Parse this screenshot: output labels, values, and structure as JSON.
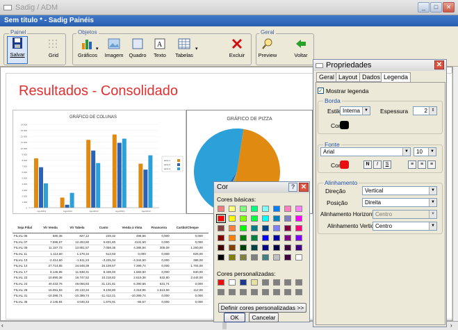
{
  "window": {
    "title": "Sadig / ADM",
    "doc_title": "Sem título * - Sadig Painéis"
  },
  "toolbar": {
    "painel_label": "Painel",
    "objetos_label": "Objetos",
    "geral_label": "Geral",
    "salvar": "Salvar",
    "grid": "Grid",
    "graficos": "Gráficos",
    "imagem": "Imagem",
    "quadro": "Quadro",
    "texto": "Texto",
    "tabelas": "Tabelas",
    "excluir": "Excluir",
    "preview": "Preview",
    "voltar": "Voltar"
  },
  "report": {
    "title": "Resultados - Consolidado",
    "bar_chart_title": "GRÁFICO DE COLUNAS",
    "pie_chart_title": "GRÁFICO DE PIZZA"
  },
  "table": {
    "headers": [
      "Seja Filial",
      "Vlr Venda",
      "Vlr Tabela",
      "Custo",
      "Venda à Vista",
      "Financeira",
      "Cartão/Cheque",
      ""
    ],
    "rows": [
      [
        "FILIAL 06",
        "590,36",
        "827,12",
        "249,32",
        "498,66",
        "0,000",
        "0,000",
        ""
      ],
      [
        "FILIAL 07",
        "7.596,67",
        "12.263,80",
        "6.831,80",
        "4131,50",
        "0,000",
        "0,000",
        ""
      ],
      [
        "FILIAL 09",
        "11.157,73",
        "13.861,57",
        "7.058,35",
        "4.386,94",
        "305,09",
        "1.260,00",
        ""
      ],
      [
        "FILIAL 11",
        "1.113,60",
        "1.179,34",
        "513,93",
        "0,000",
        "0,000",
        "825,00",
        ""
      ],
      [
        "FILIAL 13",
        "-2.414,60",
        "-1.511,23",
        "-3.225,34",
        "-4.344,50",
        "0,000",
        "388,00",
        ""
      ],
      [
        "FILIAL 14",
        "27.714,85",
        "34.548,39",
        "16.109,57",
        "7.399,74",
        "0,000",
        "1.704,00",
        ""
      ],
      [
        "FILIAL 17",
        "8.146,85",
        "11.938,31",
        "8.438,40",
        "1.683,50",
        "0,000",
        "840,00",
        ""
      ],
      [
        "FILIAL 23",
        "10.990,36",
        "19.747,52",
        "10.218,82",
        "2.619,38",
        "632,80",
        "2.444,00",
        ""
      ],
      [
        "FILIAL 24",
        "40.433,76",
        "49.066,83",
        "31.131,81",
        "6.390,66",
        "631,74",
        "0,000",
        ""
      ],
      [
        "FILIAL 28",
        "16.051,83",
        "20.133,34",
        "9.108,80",
        "4.318,95",
        "1.513,60",
        "112,00",
        ""
      ],
      [
        "FILIAL 31",
        "-10.399,74",
        "-10.399,74",
        "-11.412,21",
        "-10.399,74",
        "0,000",
        "0,000",
        ""
      ],
      [
        "FILIAL 35",
        "2.145,84",
        "4.046,43",
        "1.875,01",
        "-65,57",
        "0,000",
        "0,000",
        ""
      ]
    ]
  },
  "chart_data": [
    {
      "type": "bar",
      "title": "GRÁFICO DE COLUNAS",
      "categories": [
        "Ago/2013",
        "Ago/2013",
        "Ago/2013",
        "Ago/2013",
        "Ago/2013"
      ],
      "ylim": [
        0,
        14000
      ],
      "yticks": [
        "0",
        "1.000",
        "2.000",
        "3.000",
        "4.000",
        "5.000",
        "6.000",
        "7.000",
        "8.000",
        "9.000",
        "10.000",
        "11.000",
        "12.000",
        "13.000",
        "14.000"
      ],
      "series": [
        {
          "name": "série 1",
          "color": "#e08a12",
          "values": [
            8300,
            1700,
            11400,
            12300,
            7400
          ]
        },
        {
          "name": "série 2",
          "color": "#2a62b6",
          "values": [
            6800,
            500,
            9600,
            10900,
            6400
          ]
        },
        {
          "name": "série 3",
          "color": "#2ca0d8",
          "values": [
            4100,
            2500,
            7500,
            11600,
            8800
          ]
        }
      ],
      "legend": "right"
    },
    {
      "type": "pie",
      "title": "GRÁFICO DE PIZZA",
      "slices": [
        {
          "color": "#e08a12",
          "value": 50
        },
        {
          "color": "#a8a26a",
          "value": 4
        },
        {
          "color": "#2a62b6",
          "value": 3
        },
        {
          "color": "#2ca0d8",
          "value": 43
        }
      ]
    }
  ],
  "props": {
    "title": "Propriedades",
    "tabs": [
      "Geral",
      "Layout",
      "Dados",
      "Legenda"
    ],
    "mostrar_legenda": "Mostrar legenda",
    "borda_label": "Borda",
    "estilo_label": "Estilo",
    "estilo_value": "Interna",
    "espessura_label": "Espessura",
    "espessura_value": "2",
    "cor_label": "Cor",
    "border_color": "#000000",
    "fonte_label": "Fonte",
    "font_name": "Arial",
    "font_size": "10",
    "font_color_label": "Cor",
    "font_color": "#e81010",
    "b": "N",
    "i": "I",
    "s": "S",
    "alinhamento_label": "Alinhamento",
    "direcao_label": "Direção",
    "direcao_value": "Vertical",
    "posicao_label": "Posição",
    "posicao_value": "Direita",
    "alin_h_label": "Alinhamento Horizontal",
    "alin_h_value": "Centro",
    "alin_v_label": "Alinhamento Vertical",
    "alin_v_value": "Centro"
  },
  "cor": {
    "title": "Cor",
    "basicas": "Cores básicas:",
    "personalizadas": "Cores personalizadas:",
    "definir": "Definir cores personalizadas >>",
    "ok": "OK",
    "cancelar": "Cancelar",
    "basic_colors": [
      "#f08080",
      "#ffff80",
      "#80ff80",
      "#00ff80",
      "#80ffff",
      "#0080ff",
      "#ff80c0",
      "#ff80ff",
      "#ff0000",
      "#ffff00",
      "#80ff00",
      "#00ff40",
      "#00ffff",
      "#0080c0",
      "#8080c0",
      "#ff00ff",
      "#804040",
      "#ff8040",
      "#00ff00",
      "#008080",
      "#004080",
      "#8080ff",
      "#800040",
      "#ff0080",
      "#800000",
      "#ff8000",
      "#008000",
      "#008040",
      "#0000ff",
      "#0000a0",
      "#800080",
      "#8000ff",
      "#400000",
      "#804000",
      "#004000",
      "#004040",
      "#000080",
      "#000040",
      "#400040",
      "#400080",
      "#000000",
      "#808000",
      "#808040",
      "#808080",
      "#408080",
      "#c0c0c0",
      "#400040",
      "#ffffff"
    ],
    "custom_colors": [
      "#e81010",
      "#ffffff",
      "#1c3a8c",
      "#e8e0a0",
      "#808080",
      "#808080",
      "#808080",
      "#808080",
      "#808080",
      "#808080",
      "#808080",
      "#808080",
      "#808080",
      "#808080",
      "#808080",
      "#808080"
    ]
  }
}
